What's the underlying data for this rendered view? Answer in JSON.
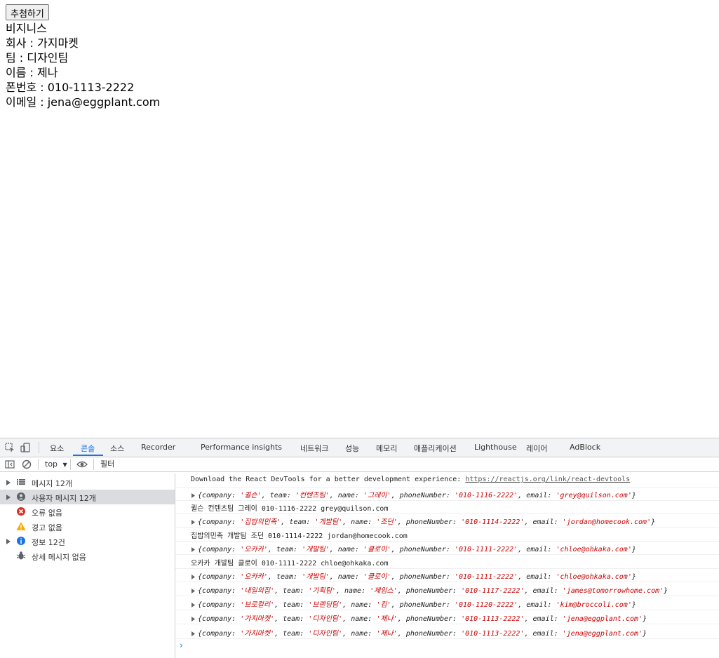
{
  "page": {
    "button_label": "추첨하기",
    "card_type": "비지니스",
    "company_line": "회사 : 가지마켓",
    "team_line": "팀 : 디자인팀",
    "name_line": "이름 : 제나",
    "phone_line": "폰번호 : 010-1113-2222",
    "email_line": "이메일 : jena@eggplant.com"
  },
  "devtools": {
    "tabs": [
      "요소",
      "콘솔",
      "소스",
      "Recorder",
      "Performance insights",
      "네트워크",
      "성능",
      "메모리",
      "애플리케이션",
      "Lighthouse",
      "레이어",
      "AdBlock"
    ],
    "active_tab": "콘솔",
    "context_label": "top",
    "filter_placeholder": "필터",
    "sidebar": [
      {
        "label": "메시지 12개",
        "icon": "list-icon",
        "expandable": true
      },
      {
        "label": "사용자 메시지 12개",
        "icon": "user-icon",
        "expandable": true,
        "selected": true
      },
      {
        "label": "오류 없음",
        "icon": "error-icon",
        "expandable": false
      },
      {
        "label": "경고 없음",
        "icon": "warning-icon",
        "expandable": false
      },
      {
        "label": "정보 12건",
        "icon": "info-icon",
        "expandable": true
      },
      {
        "label": "상세 메시지 없음",
        "icon": "bug-icon",
        "expandable": false
      }
    ],
    "console_messages": [
      {
        "type": "text",
        "text": "Download the React DevTools for a better development experience: ",
        "link": "https://reactjs.org/link/react-devtools"
      },
      {
        "type": "object",
        "company": "퀼슨",
        "team": "컨텐츠팀",
        "name": "그레이",
        "phoneNumber": "010-1116-2222",
        "email": "grey@quilson.com"
      },
      {
        "type": "text",
        "text": "퀼슨 컨텐츠팀 그레이 010-1116-2222 grey@quilson.com"
      },
      {
        "type": "object",
        "company": "집밥의민족",
        "team": "개발팀",
        "name": "조던",
        "phoneNumber": "010-1114-2222",
        "email": "jordan@homecook.com"
      },
      {
        "type": "text",
        "text": "집밥의민족 개발팀 조던 010-1114-2222 jordan@homecook.com"
      },
      {
        "type": "object",
        "company": "오카카",
        "team": "개발팀",
        "name": "클로이",
        "phoneNumber": "010-1111-2222",
        "email": "chloe@ohkaka.com"
      },
      {
        "type": "text",
        "text": "오카카 개발팀 클로이 010-1111-2222 chloe@ohkaka.com"
      },
      {
        "type": "object",
        "company": "오카카",
        "team": "개발팀",
        "name": "클로이",
        "phoneNumber": "010-1111-2222",
        "email": "chloe@ohkaka.com"
      },
      {
        "type": "object",
        "company": "내일의집",
        "team": "기획팀",
        "name": "제임스",
        "phoneNumber": "010-1117-2222",
        "email": "james@tomorrowhome.com"
      },
      {
        "type": "object",
        "company": "브로컬리",
        "team": "브랜딩팀",
        "name": "킴",
        "phoneNumber": "010-1120-2222",
        "email": "kim@broccoli.com"
      },
      {
        "type": "object",
        "company": "가지마켓",
        "team": "디자인팀",
        "name": "제나",
        "phoneNumber": "010-1113-2222",
        "email": "jena@eggplant.com"
      },
      {
        "type": "object",
        "company": "가지마켓",
        "team": "디자인팀",
        "name": "제나",
        "phoneNumber": "010-1113-2222",
        "email": "jena@eggplant.com"
      }
    ],
    "prompt_symbol": "›"
  },
  "colors": {
    "accent": "#1a73e8",
    "string_value": "#c80000",
    "selected_bg": "#dadce0",
    "error": "#d93025",
    "warning": "#f9ab00",
    "info": "#1a73e8"
  }
}
